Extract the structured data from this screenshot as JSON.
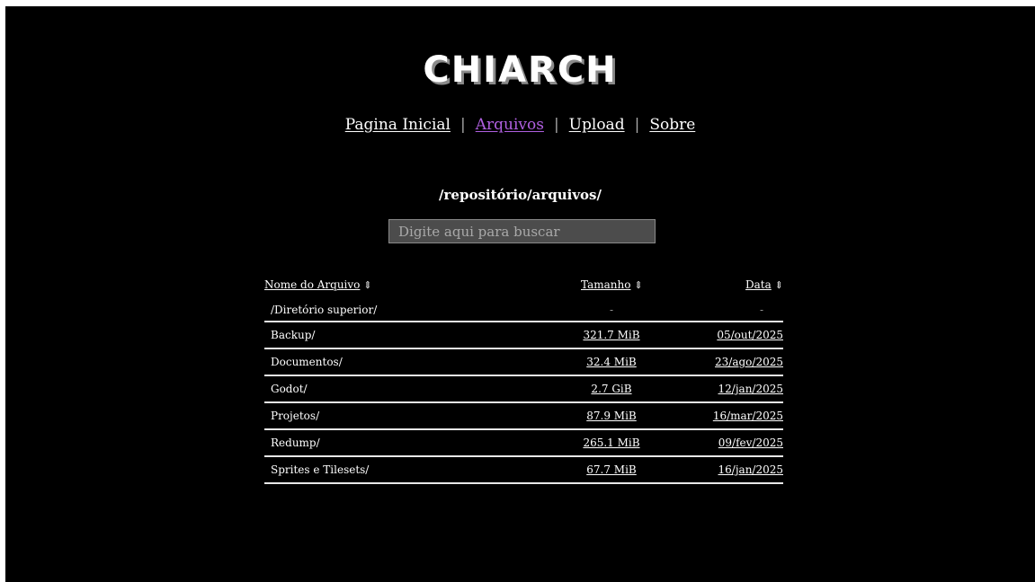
{
  "site": {
    "logo": "CHIARCH"
  },
  "nav": {
    "items": [
      {
        "label": "Pagina Inicial",
        "active": false
      },
      {
        "label": "Arquivos",
        "active": true
      },
      {
        "label": "Upload",
        "active": false
      },
      {
        "label": "Sobre",
        "active": false
      }
    ],
    "separator": "|",
    "active_color": "#b060e0"
  },
  "path": "/repositório/arquivos/",
  "search": {
    "placeholder": "Digite aqui para buscar",
    "value": ""
  },
  "table": {
    "headers": {
      "name": "Nome do Arquivo",
      "size": "Tamanho",
      "date": "Data",
      "sort_icon": "sort-arrows-icon"
    },
    "parent_row": {
      "name": "/Diretório superior/",
      "size": "-",
      "date": "-"
    },
    "rows": [
      {
        "name": "Backup/",
        "size": "321.7 MiB",
        "date": "05/out/2025"
      },
      {
        "name": "Documentos/",
        "size": "32.4 MiB",
        "date": "23/ago/2025"
      },
      {
        "name": "Godot/",
        "size": "2.7 GiB",
        "date": "12/jan/2025"
      },
      {
        "name": "Projetos/",
        "size": "87.9 MiB",
        "date": "16/mar/2025"
      },
      {
        "name": "Redump/",
        "size": "265.1 MiB",
        "date": "09/fev/2025"
      },
      {
        "name": "Sprites e Tilesets/",
        "size": "67.7 MiB",
        "date": "16/jan/2025"
      }
    ]
  }
}
